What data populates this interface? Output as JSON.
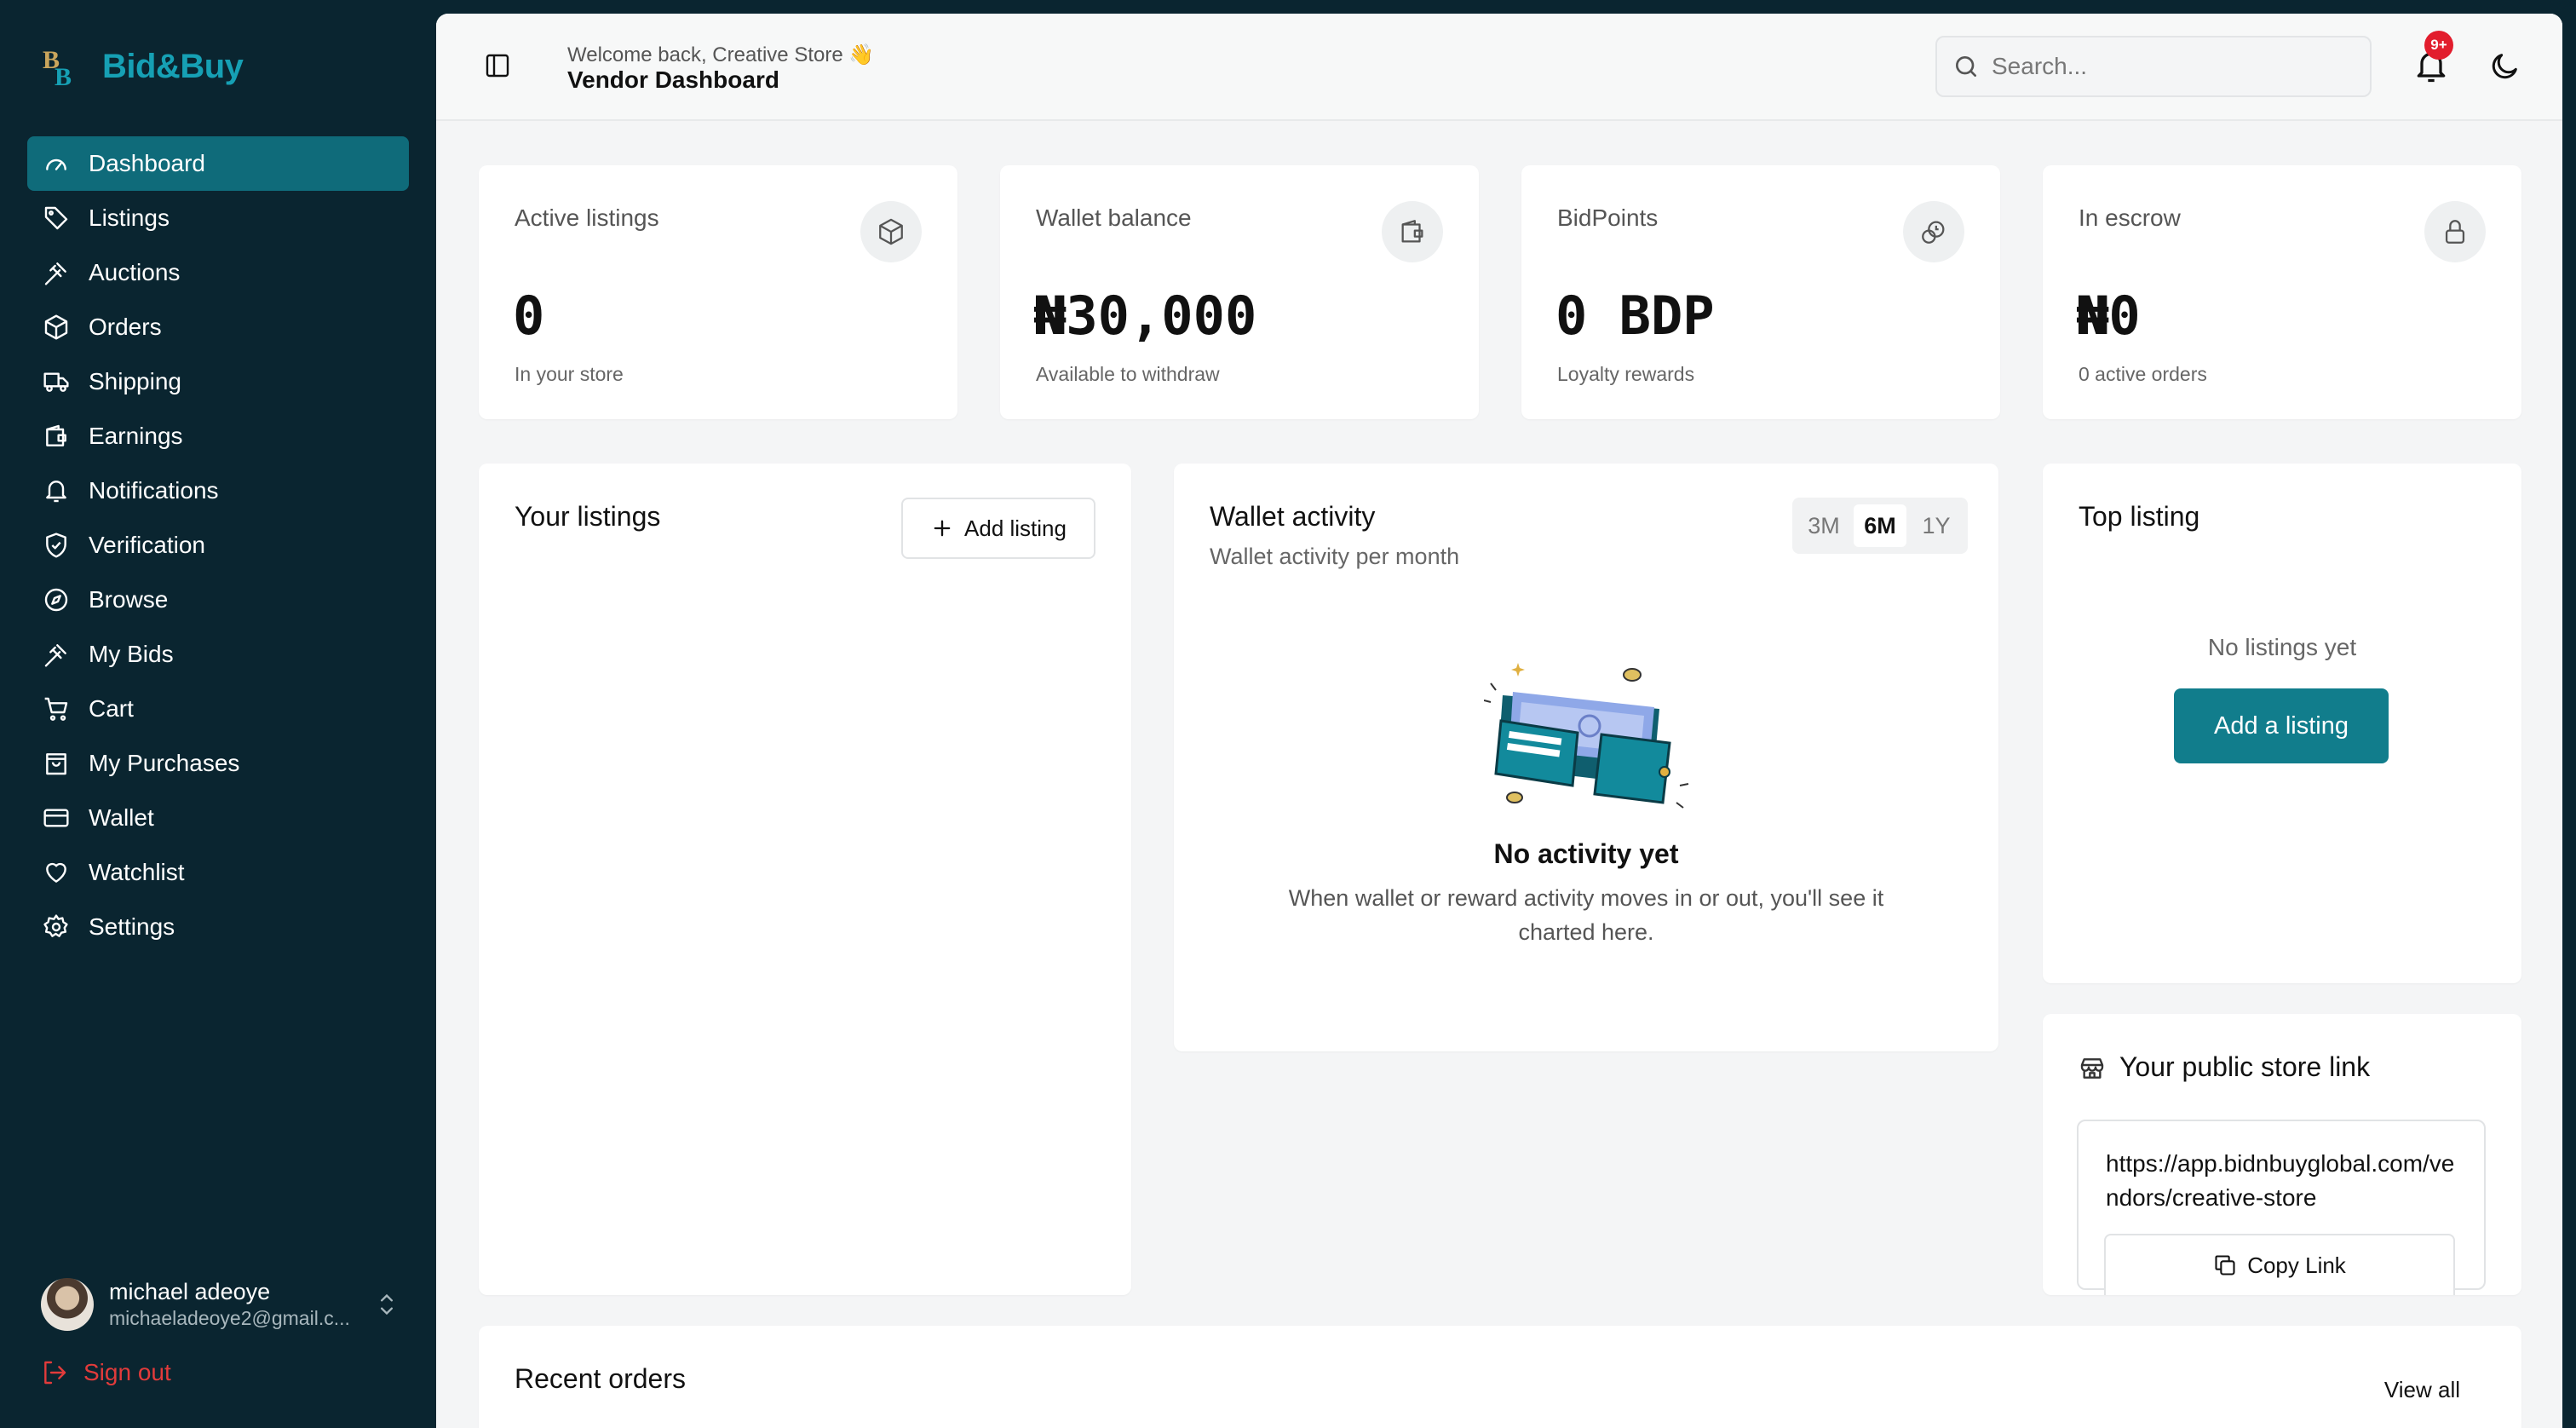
{
  "app": {
    "name": "Bid&Buy"
  },
  "colors": {
    "sidebar_bg": "#0a2530",
    "accent": "#117d8c",
    "active_nav": "#0f6b7a",
    "danger": "#e23b3b",
    "badge": "#e21d2d"
  },
  "sidebar": {
    "items": [
      {
        "label": "Dashboard",
        "icon": "dashboard-icon",
        "active": true
      },
      {
        "label": "Listings",
        "icon": "tag-icon"
      },
      {
        "label": "Auctions",
        "icon": "gavel-icon"
      },
      {
        "label": "Orders",
        "icon": "box-icon"
      },
      {
        "label": "Shipping",
        "icon": "truck-icon"
      },
      {
        "label": "Earnings",
        "icon": "wallet-icon"
      },
      {
        "label": "Notifications",
        "icon": "bell-icon"
      },
      {
        "label": "Verification",
        "icon": "shield-check-icon"
      },
      {
        "label": "Browse",
        "icon": "compass-icon"
      },
      {
        "label": "My Bids",
        "icon": "gavel-icon"
      },
      {
        "label": "Cart",
        "icon": "cart-icon"
      },
      {
        "label": "My Purchases",
        "icon": "bag-icon"
      },
      {
        "label": "Wallet",
        "icon": "card-icon"
      },
      {
        "label": "Watchlist",
        "icon": "heart-icon"
      },
      {
        "label": "Settings",
        "icon": "gear-icon"
      }
    ],
    "user": {
      "name": "michael adeoye",
      "email": "michaeladeoye2@gmail.c..."
    },
    "signout_label": "Sign out"
  },
  "header": {
    "greeting": "Welcome back, Creative Store 👋",
    "title": "Vendor Dashboard",
    "search_placeholder": "Search...",
    "notification_count": "9+"
  },
  "stats": [
    {
      "label": "Active listings",
      "value": "0",
      "sub": "In your store",
      "icon": "box-icon"
    },
    {
      "label": "Wallet balance",
      "value": "₦30,000",
      "sub": "Available to withdraw",
      "icon": "wallet-icon"
    },
    {
      "label": "BidPoints",
      "value": "0 BDP",
      "sub": "Loyalty rewards",
      "icon": "coins-icon"
    },
    {
      "label": "In escrow",
      "value": "₦0",
      "sub": "0 active orders",
      "icon": "lock-icon"
    }
  ],
  "listings": {
    "title": "Your listings",
    "add_label": "Add listing"
  },
  "wallet_activity": {
    "title": "Wallet activity",
    "subtitle": "Wallet activity per month",
    "ranges": [
      "3M",
      "6M",
      "1Y"
    ],
    "selected_range": "6M",
    "empty_title": "No activity yet",
    "empty_text": "When wallet or reward activity moves in or out, you'll see it charted here."
  },
  "top_listing": {
    "title": "Top listing",
    "empty": "No listings yet",
    "cta": "Add a listing"
  },
  "store_link": {
    "title": "Your public store link",
    "url": "https://app.bidnbuyglobal.com/vendors/creative-store",
    "copy_label": "Copy Link"
  },
  "recent_orders": {
    "title": "Recent orders",
    "view_all": "View all"
  }
}
